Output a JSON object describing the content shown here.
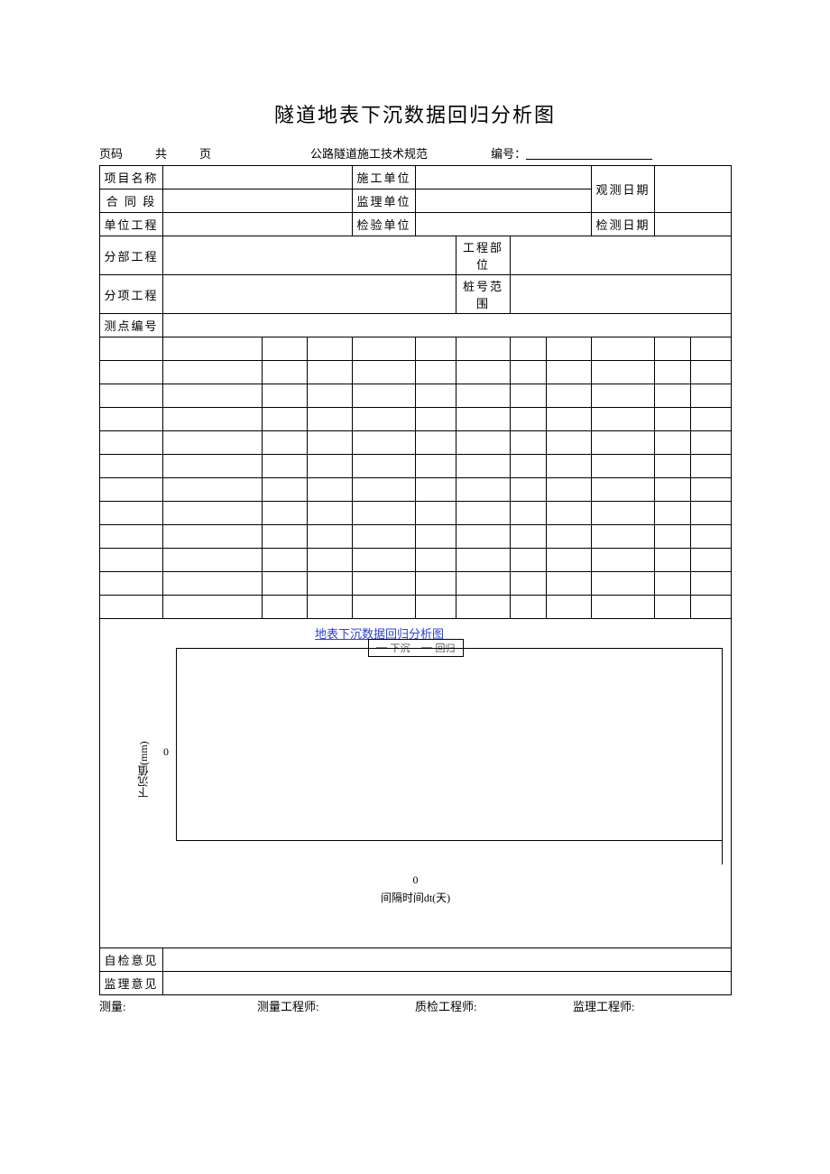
{
  "title": "隧道地表下沉数据回归分析图",
  "meta": {
    "page_label": "页码",
    "total_label": "共",
    "page_unit": "页",
    "spec": "公路隧道施工技术规范",
    "number_label": "编号："
  },
  "head": {
    "project_name": "项目名称",
    "contract_section": "合 同 段",
    "unit_project": "单位工程",
    "construction_unit": "施工单位",
    "supervision_unit": "监理单位",
    "inspection_unit": "检验单位",
    "obs_date": "观测日期",
    "test_date": "检测日期",
    "sub_project": "分部工程",
    "item_project": "分项工程",
    "point_no": "测点编号",
    "eng_part": "工程部位",
    "station_range": "桩号范围"
  },
  "chart_data": {
    "type": "line",
    "title": "地表下沉数据回归分析图",
    "series": [
      {
        "name": "下沉",
        "values": []
      },
      {
        "name": "回归",
        "values": []
      }
    ],
    "x": [],
    "ylabel": "下沉值(mm)",
    "xlabel": "间隔时间dt(天)",
    "y_tick": "0",
    "x_tick": "0"
  },
  "opinions": {
    "self_check": "自检意见",
    "supervision": "监理意见"
  },
  "footer": {
    "measure": "测量:",
    "measure_eng": "测量工程师:",
    "qc_eng": "质检工程师:",
    "sup_eng": "监理工程师:"
  }
}
